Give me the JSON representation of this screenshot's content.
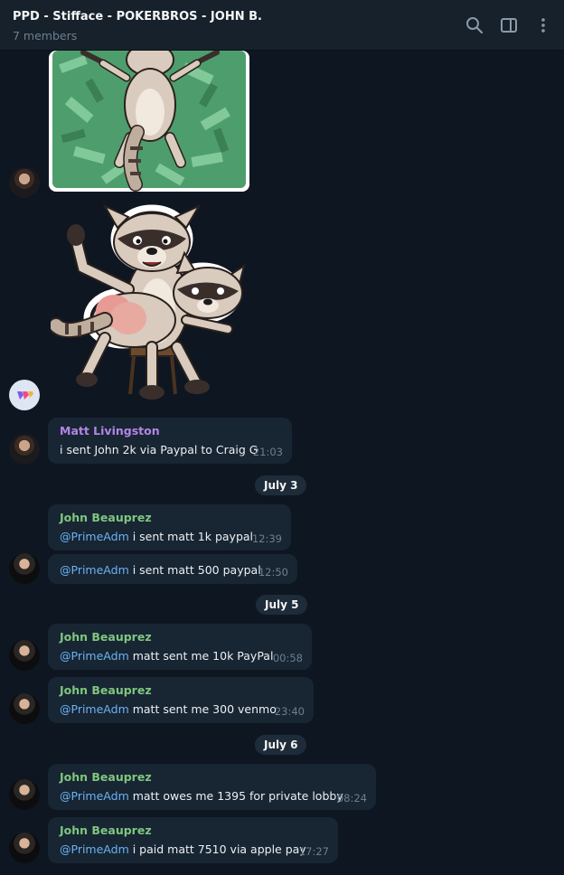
{
  "header": {
    "title": "PPD - Stifface - POKERBROS - JOHN B.",
    "subtitle": "7 members",
    "icons": [
      "search-icon",
      "sidebar-toggle-icon",
      "more-vertical-icon"
    ]
  },
  "colors": {
    "background": "#0e1621",
    "header": "#17212b",
    "bubble": "#182533",
    "name_matt": "#b286e6",
    "name_john": "#7ec77e",
    "mention": "#6ab3f3",
    "time": "#6d7f8f"
  },
  "messages": [
    {
      "sender": "Matt Livingston",
      "text": "i sent John 2k via Paypal to Craig G",
      "time": "21:03"
    },
    {
      "date": "July 3"
    },
    {
      "sender": "John Beauprez",
      "mention": "@PrimeAdm",
      "text": " i sent matt 1k paypal",
      "time": "12:39"
    },
    {
      "mention": "@PrimeAdm",
      "text": " i sent matt 500 paypal",
      "time": "12:50"
    },
    {
      "date": "July 5"
    },
    {
      "sender": "John Beauprez",
      "mention": "@PrimeAdm",
      "text": " matt sent me 10k PayPal",
      "time": "00:58"
    },
    {
      "sender": "John Beauprez",
      "mention": "@PrimeAdm",
      "text": " matt sent me 300 venmo",
      "time": "23:40"
    },
    {
      "date": "July 6"
    },
    {
      "sender": "John Beauprez",
      "mention": "@PrimeAdm",
      "text": " matt owes me 1395 for private lobby",
      "time": "08:24"
    },
    {
      "sender": "John Beauprez",
      "mention": "@PrimeAdm",
      "text": " i paid matt 7510 via apple pay",
      "time": "17:27"
    }
  ]
}
